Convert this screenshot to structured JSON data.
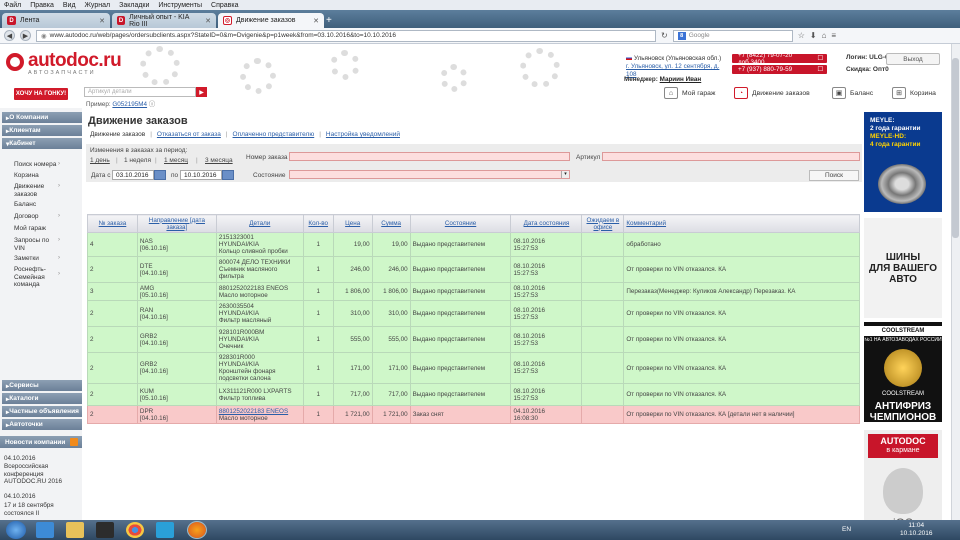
{
  "browser": {
    "menu": [
      "Файл",
      "Правка",
      "Вид",
      "Журнал",
      "Закладки",
      "Инструменты",
      "Справка"
    ],
    "tabs": [
      {
        "label": "Лента",
        "active": false
      },
      {
        "label": "Личный опыт - KIA Rio III",
        "active": false
      },
      {
        "label": "Движение заказов",
        "active": true
      }
    ],
    "url": "www.autodoc.ru/web/pages/ordersubclients.aspx?StateID=0&m=Dvigenie&p=p1week&from=03.10.2016&to=10.10.2016",
    "search_placeholder": "Google"
  },
  "header": {
    "logo_name": "autodoc",
    "logo_tld": ".ru",
    "logo_sub": "АВТОЗАПЧАСТИ",
    "region": "Ульяновск (Ульяновская обл.)",
    "address": "г. Ульяновск, ул. 12 сентября, д. 108",
    "phone1": "+7 (8422) 79-07-20 доб.3400",
    "phone2": "+7 (937) 880-79-59",
    "login_label": "Логин:",
    "login_value": "ULG-61",
    "discount_label": "Скидка:",
    "discount_value": "Опт0",
    "exit_label": "Выход",
    "manager_label": "Менеджер:",
    "manager_name": "Мариин Иван"
  },
  "toolbar": {
    "hot_button": "ХОЧУ НА ГОНКУ!",
    "part_placeholder": "Артикул детали",
    "example_label": "Пример:",
    "example_value": "G052195M4",
    "nav": [
      "Мой гараж",
      "Движение заказов",
      "Баланс",
      "Корзина"
    ]
  },
  "sidebar": {
    "sections_top": [
      "О Компании",
      "Клиентам",
      "Кабинет"
    ],
    "cabinet_items": [
      "Поиск номера",
      "Корзина",
      "Движение заказов",
      "Баланс",
      "Договор",
      "Мой гараж",
      "Запросы по VIN",
      "Заметки",
      "Роснефть-Семейная команда"
    ],
    "sections_bottom": [
      "Сервисы",
      "Каталоги",
      "Частные объявления",
      "Автоточки"
    ],
    "news_title": "Новости компании",
    "news": [
      {
        "date": "04.10.2016",
        "text": "Всероссийская конференция AUTODOC.RU 2016"
      },
      {
        "date": "04.10.2016",
        "text": "17 и 18 сентября состоялся II"
      }
    ]
  },
  "page": {
    "title": "Движение заказов",
    "subnav": [
      "Движение заказов",
      "Отказаться от заказа",
      "Оплаченнo представителю",
      "Настройка уведомлений"
    ],
    "period_label": "Изменения в заказах за период:",
    "periods": [
      "1 день",
      "1 неделя",
      "1 месяц",
      "3 месяца"
    ],
    "date_from_label": "Дата с",
    "date_from": "03.10.2016",
    "date_to_label": "по",
    "date_to": "10.10.2016",
    "order_num_label": "Номер заказа",
    "article_label": "Артикул",
    "state_label": "Состояние",
    "search_button": "Поиск"
  },
  "table": {
    "columns": [
      "№ заказа",
      "Направление [дата заказа]",
      "Детали",
      "Кол-во",
      "Цена",
      "Сумма",
      "Состояние",
      "Дата состояния",
      "Ожидаем в офисе",
      "Комментарий"
    ],
    "rows": [
      {
        "num": "4",
        "dir": "NAS",
        "dir_date": "[06.10.16]",
        "code": "2151323001",
        "brand": "HYUNDAI/KIA",
        "desc": "Кольцо сливной пробки",
        "qty": "1",
        "price": "19,00",
        "sum": "19,00",
        "state": "Выдано представителем",
        "sdate": "08.10.2016",
        "stime": "15:27:53",
        "expect": "",
        "comment": "обработано",
        "status": "g"
      },
      {
        "num": "2",
        "dir": "DTE",
        "dir_date": "[04.10.16]",
        "code": "800074 ДЕЛО ТЕХНИКИ",
        "brand": "",
        "desc": "Съемник масляного фильтра",
        "qty": "1",
        "price": "246,00",
        "sum": "246,00",
        "state": "Выдано представителем",
        "sdate": "08.10.2016",
        "stime": "15:27:53",
        "expect": "",
        "comment": "От проверки по VIN отказался. КА",
        "status": "g"
      },
      {
        "num": "3",
        "dir": "AMG",
        "dir_date": "[05.10.16]",
        "code": "8801252022183 ENEOS",
        "brand": "",
        "desc": "Масло моторное",
        "qty": "1",
        "price": "1 806,00",
        "sum": "1 806,00",
        "state": "Выдано представителем",
        "sdate": "08.10.2016",
        "stime": "15:27:53",
        "expect": "",
        "comment": "Перезаказ(Менеджер: Куликов Александр) Перезаказ. КА",
        "status": "g"
      },
      {
        "num": "2",
        "dir": "RAN",
        "dir_date": "[04.10.16]",
        "code": "2630035504",
        "brand": "HYUNDAI/KIA",
        "desc": "Фильтр масляный",
        "qty": "1",
        "price": "310,00",
        "sum": "310,00",
        "state": "Выдано представителем",
        "sdate": "08.10.2016",
        "stime": "15:27:53",
        "expect": "",
        "comment": "От проверки по VIN отказался. КА",
        "status": "g"
      },
      {
        "num": "2",
        "dir": "GRB2",
        "dir_date": "[04.10.16]",
        "code": "928101R000BM",
        "brand": "HYUNDAI/KIA",
        "desc": "Очечник",
        "qty": "1",
        "price": "555,00",
        "sum": "555,00",
        "state": "Выдано представителем",
        "sdate": "08.10.2016",
        "stime": "15:27:53",
        "expect": "",
        "comment": "От проверки по VIN отказался. КА",
        "status": "g"
      },
      {
        "num": "2",
        "dir": "GRB2",
        "dir_date": "[04.10.16]",
        "code": "928301R000",
        "brand": "HYUNDAI/KIA",
        "desc": "Кронштейн фонаря подсветки салона",
        "qty": "1",
        "price": "171,00",
        "sum": "171,00",
        "state": "Выдано представителем",
        "sdate": "08.10.2016",
        "stime": "15:27:53",
        "expect": "",
        "comment": "От проверки по VIN отказался. КА",
        "status": "g"
      },
      {
        "num": "2",
        "dir": "KUM",
        "dir_date": "[05.10.16]",
        "code": "LX311121R000 LXPARTS",
        "brand": "",
        "desc": "Фильтр топлива",
        "qty": "1",
        "price": "717,00",
        "sum": "717,00",
        "state": "Выдано представителем",
        "sdate": "08.10.2016",
        "stime": "15:27:53",
        "expect": "",
        "comment": "От проверки по VIN отказался. КА",
        "status": "g"
      },
      {
        "num": "2",
        "dir": "DPR",
        "dir_date": "[04.10.16]",
        "code": "8801252022183 ENEOS",
        "brand": "",
        "desc": "Масло моторное",
        "qty": "1",
        "price": "1 721,00",
        "sum": "1 721,00",
        "state": "Заказ снят",
        "sdate": "04.10.2016",
        "stime": "16:08:30",
        "expect": "",
        "comment": "От проверки по VIN отказался. КА [детали нет в наличии]",
        "status": "r"
      }
    ]
  },
  "banners": {
    "meyle_line1": "MEYLE:",
    "meyle_line2": "2 года гарантии",
    "meyle_line3": "MEYLE-HD:",
    "meyle_line4": "4 года гарантии",
    "tires_line1": "ШИНЫ",
    "tires_line2": "ДЛЯ ВАШЕГО",
    "tires_line3": "АВТО",
    "coolstream_title": "COOLSTREAM",
    "coolstream_sub": "№1 НА АВТОЗАВОДАХ РОССИИ",
    "coolstream_brand": "COOLSTREAM",
    "coolstream_big1": "АНТИФРИЗ",
    "coolstream_big2": "ЧЕМПИОНОВ",
    "app_line1": "AUTODOC",
    "app_line2": "в кармане",
    "app_os": "iOS"
  },
  "taskbar": {
    "lang": "EN",
    "time": "11:04",
    "date": "10.10.2016"
  }
}
